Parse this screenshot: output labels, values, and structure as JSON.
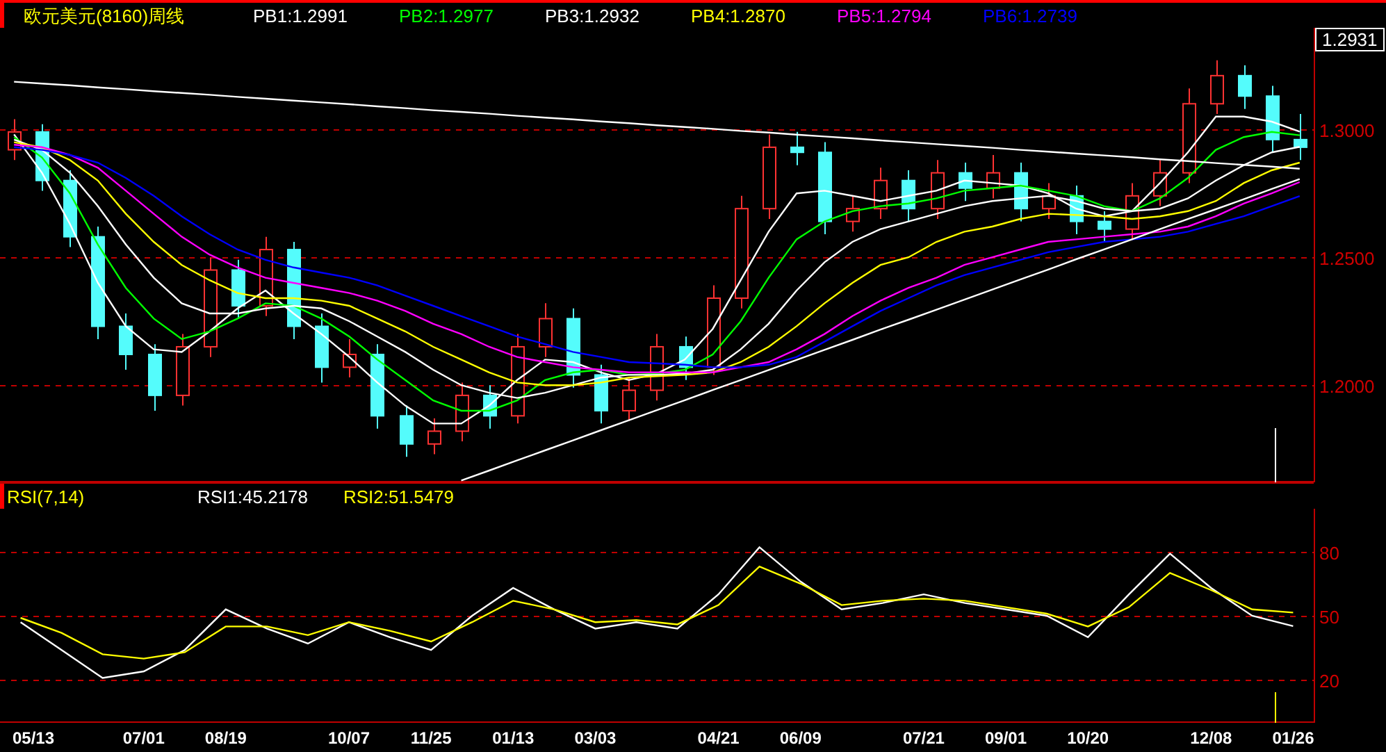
{
  "header": {
    "title": "欧元美元(8160)周线"
  },
  "price_chart": {
    "current_price": "1.2931",
    "chart_data": {
      "type": "candlestick",
      "grid": true,
      "categories": [
        null,
        null,
        null,
        null,
        null,
        null,
        null,
        null,
        null,
        null,
        null,
        null,
        null,
        null,
        null,
        null,
        null,
        null,
        null,
        null,
        null,
        null,
        null,
        null,
        null,
        null,
        null,
        null,
        null,
        null,
        null,
        null,
        null,
        null,
        null,
        null,
        null,
        null,
        null,
        null,
        null,
        null,
        null,
        null,
        null,
        null,
        null
      ],
      "ylim": [
        1.162,
        1.3397
      ],
      "yticks": [
        {
          "value": 1.2,
          "label": "1.2000"
        },
        {
          "value": 1.25,
          "label": "1.2500"
        },
        {
          "value": 1.3,
          "label": "1.3000"
        }
      ],
      "ohlc": [
        [
          1.292,
          1.304,
          1.288,
          1.299
        ],
        [
          1.299,
          1.302,
          1.276,
          1.28
        ],
        [
          1.28,
          1.284,
          1.254,
          1.258
        ],
        [
          1.258,
          1.262,
          1.218,
          1.223
        ],
        [
          1.223,
          1.228,
          1.206,
          1.212
        ],
        [
          1.212,
          1.216,
          1.19,
          1.196
        ],
        [
          1.196,
          1.22,
          1.192,
          1.215
        ],
        [
          1.215,
          1.25,
          1.211,
          1.245
        ],
        [
          1.245,
          1.249,
          1.226,
          1.231
        ],
        [
          1.231,
          1.258,
          1.227,
          1.253
        ],
        [
          1.253,
          1.256,
          1.218,
          1.223
        ],
        [
          1.223,
          1.228,
          1.201,
          1.207
        ],
        [
          1.207,
          1.218,
          1.203,
          1.212
        ],
        [
          1.212,
          1.216,
          1.183,
          1.188
        ],
        [
          1.188,
          1.192,
          1.172,
          1.177
        ],
        [
          1.177,
          1.187,
          1.173,
          1.182
        ],
        [
          1.182,
          1.201,
          1.178,
          1.196
        ],
        [
          1.196,
          1.2,
          1.183,
          1.188
        ],
        [
          1.188,
          1.22,
          1.185,
          1.215
        ],
        [
          1.215,
          1.232,
          1.211,
          1.226
        ],
        [
          1.226,
          1.23,
          1.199,
          1.204
        ],
        [
          1.204,
          1.208,
          1.185,
          1.19
        ],
        [
          1.19,
          1.203,
          1.186,
          1.198
        ],
        [
          1.198,
          1.22,
          1.194,
          1.215
        ],
        [
          1.215,
          1.219,
          1.202,
          1.207
        ],
        [
          1.207,
          1.239,
          1.204,
          1.234
        ],
        [
          1.234,
          1.274,
          1.23,
          1.269
        ],
        [
          1.269,
          1.298,
          1.265,
          1.293
        ],
        [
          1.293,
          1.299,
          1.286,
          1.291
        ],
        [
          1.291,
          1.295,
          1.259,
          1.264
        ],
        [
          1.264,
          1.274,
          1.26,
          1.269
        ],
        [
          1.269,
          1.285,
          1.265,
          1.28
        ],
        [
          1.28,
          1.284,
          1.264,
          1.269
        ],
        [
          1.269,
          1.288,
          1.265,
          1.283
        ],
        [
          1.283,
          1.287,
          1.272,
          1.277
        ],
        [
          1.277,
          1.29,
          1.273,
          1.283
        ],
        [
          1.283,
          1.287,
          1.264,
          1.269
        ],
        [
          1.269,
          1.279,
          1.265,
          1.274
        ],
        [
          1.274,
          1.278,
          1.259,
          1.264
        ],
        [
          1.264,
          1.268,
          1.256,
          1.261
        ],
        [
          1.261,
          1.279,
          1.257,
          1.274
        ],
        [
          1.274,
          1.288,
          1.27,
          1.283
        ],
        [
          1.283,
          1.316,
          1.279,
          1.31
        ],
        [
          1.31,
          1.327,
          1.306,
          1.321
        ],
        [
          1.321,
          1.325,
          1.308,
          1.313
        ],
        [
          1.313,
          1.317,
          1.291,
          1.296
        ],
        [
          1.296,
          1.306,
          1.288,
          1.293
        ]
      ],
      "series": [
        {
          "name": "PB1:1.2991",
          "type": "line",
          "color": "#ffffff",
          "values": [
            1.298,
            1.283,
            1.263,
            1.24,
            1.223,
            1.214,
            1.213,
            1.221,
            1.23,
            1.237,
            1.228,
            1.22,
            1.211,
            1.201,
            1.192,
            1.185,
            1.185,
            1.192,
            1.202,
            1.21,
            1.209,
            1.205,
            1.202,
            1.2045,
            1.21,
            1.222,
            1.241,
            1.26,
            1.275,
            1.276,
            1.274,
            1.272,
            1.274,
            1.276,
            1.28,
            1.279,
            1.278,
            1.275,
            1.269,
            1.266,
            1.268,
            1.279,
            1.291,
            1.305,
            1.305,
            1.303,
            1.2991
          ]
        },
        {
          "name": "PB2:1.2977",
          "type": "line",
          "color": "#00ff00",
          "values": [
            1.297,
            1.289,
            1.275,
            1.255,
            1.238,
            1.226,
            1.218,
            1.221,
            1.226,
            1.232,
            1.231,
            1.226,
            1.219,
            1.21,
            1.202,
            1.194,
            1.19,
            1.19,
            1.194,
            1.202,
            1.205,
            1.206,
            1.204,
            1.2045,
            1.206,
            1.212,
            1.225,
            1.242,
            1.257,
            1.264,
            1.268,
            1.27,
            1.271,
            1.273,
            1.276,
            1.277,
            1.278,
            1.276,
            1.274,
            1.27,
            1.268,
            1.273,
            1.281,
            1.292,
            1.297,
            1.299,
            1.2977
          ]
        },
        {
          "name": "PB3:1.2932",
          "type": "line",
          "color": "#ffffff",
          "values": [
            1.296,
            1.292,
            1.283,
            1.27,
            1.255,
            1.242,
            1.232,
            1.228,
            1.228,
            1.23,
            1.231,
            1.23,
            1.225,
            1.219,
            1.213,
            1.206,
            1.2,
            1.197,
            1.195,
            1.197,
            1.2,
            1.203,
            1.204,
            1.204,
            1.2045,
            1.206,
            1.214,
            1.224,
            1.237,
            1.248,
            1.256,
            1.261,
            1.264,
            1.267,
            1.27,
            1.272,
            1.273,
            1.274,
            1.272,
            1.269,
            1.268,
            1.269,
            1.273,
            1.28,
            1.286,
            1.291,
            1.2932
          ]
        },
        {
          "name": "PB4:1.2870",
          "type": "line",
          "color": "#ffff00",
          "values": [
            1.295,
            1.293,
            1.288,
            1.28,
            1.267,
            1.256,
            1.247,
            1.241,
            1.236,
            1.234,
            1.234,
            1.233,
            1.231,
            1.226,
            1.221,
            1.215,
            1.21,
            1.205,
            1.201,
            1.2,
            1.2,
            1.201,
            1.203,
            1.2035,
            1.204,
            1.205,
            1.209,
            1.215,
            1.223,
            1.232,
            1.24,
            1.247,
            1.25,
            1.256,
            1.26,
            1.262,
            1.265,
            1.267,
            1.2665,
            1.266,
            1.265,
            1.266,
            1.268,
            1.272,
            1.279,
            1.284,
            1.287
          ]
        },
        {
          "name": "PB5:1.2794",
          "type": "line",
          "color": "#ff00ff",
          "values": [
            1.294,
            1.293,
            1.29,
            1.285,
            1.276,
            1.267,
            1.258,
            1.251,
            1.246,
            1.242,
            1.24,
            1.238,
            1.236,
            1.233,
            1.229,
            1.224,
            1.22,
            1.215,
            1.211,
            1.209,
            1.207,
            1.206,
            1.205,
            1.205,
            1.205,
            1.205,
            1.207,
            1.209,
            1.214,
            1.22,
            1.227,
            1.233,
            1.238,
            1.242,
            1.247,
            1.25,
            1.253,
            1.256,
            1.257,
            1.258,
            1.259,
            1.26,
            1.262,
            1.266,
            1.271,
            1.275,
            1.2794
          ]
        },
        {
          "name": "PB6:1.2739",
          "type": "line",
          "color": "#0000ff",
          "values": [
            1.293,
            1.292,
            1.29,
            1.287,
            1.281,
            1.274,
            1.266,
            1.259,
            1.253,
            1.249,
            1.246,
            1.244,
            1.242,
            1.239,
            1.235,
            1.231,
            1.227,
            1.223,
            1.219,
            1.216,
            1.213,
            1.211,
            1.209,
            1.2085,
            1.208,
            1.207,
            1.207,
            1.208,
            1.211,
            1.217,
            1.223,
            1.229,
            1.234,
            1.239,
            1.243,
            1.246,
            1.249,
            1.252,
            1.254,
            1.256,
            1.257,
            1.258,
            1.26,
            1.263,
            1.266,
            1.27,
            1.2739
          ]
        },
        {
          "type": "line",
          "color": "#ffffff",
          "values": [
            1.3186,
            1.3179,
            1.3172,
            1.3164,
            1.3157,
            1.3149,
            1.3142,
            1.3135,
            1.3127,
            1.312,
            1.3112,
            1.3105,
            1.3098,
            1.309,
            1.3083,
            1.3075,
            1.3068,
            1.3061,
            1.3053,
            1.3046,
            1.3039,
            1.3031,
            1.3024,
            1.3016,
            1.3009,
            1.3002,
            1.2994,
            1.2987,
            1.2979,
            1.2972,
            1.2965,
            1.2957,
            1.295,
            1.2942,
            1.2935,
            1.2928,
            1.292,
            1.2913,
            1.2905,
            1.2898,
            1.2891,
            1.2883,
            1.2876,
            1.2868,
            1.2861,
            1.2854,
            1.2846
          ]
        },
        {
          "type": "line",
          "color": "#ffffff",
          "values": [
            null,
            null,
            null,
            null,
            null,
            null,
            null,
            null,
            null,
            null,
            null,
            null,
            null,
            null,
            null,
            null,
            1.1627,
            1.1666,
            1.1706,
            1.1745,
            1.1784,
            1.1824,
            1.1863,
            1.1902,
            1.1941,
            1.1981,
            1.202,
            1.2059,
            1.2099,
            1.2138,
            1.2177,
            1.2217,
            1.2256,
            1.2295,
            1.2334,
            1.2374,
            1.2413,
            1.2452,
            1.2492,
            1.2531,
            1.257,
            1.261,
            1.2649,
            1.2688,
            1.2727,
            1.2767,
            1.2806
          ]
        }
      ]
    }
  },
  "rsi_panel": {
    "title": "RSI(7,14)",
    "chart_data": {
      "type": "line",
      "grid": true,
      "categories": [
        "05/13",
        null,
        null,
        "07/01",
        null,
        "08/19",
        null,
        null,
        "10/07",
        null,
        "11/25",
        null,
        "01/13",
        null,
        "03/03",
        null,
        null,
        "04/21",
        null,
        "06/09",
        null,
        null,
        "07/21",
        null,
        "09/01",
        null,
        "10/20",
        null,
        null,
        "12/08",
        null,
        "01/26"
      ],
      "ylim": [
        0,
        100
      ],
      "yticks": [
        20,
        50,
        80
      ],
      "series": [
        {
          "name": "RSI1:45.2178",
          "color": "#ffffff",
          "values": [
            47,
            34,
            21,
            24,
            34,
            53,
            44,
            37,
            47,
            40,
            34,
            50,
            63,
            53,
            44,
            47,
            44,
            60,
            82,
            66,
            53,
            56,
            60,
            56,
            53,
            50,
            40,
            60,
            79,
            63,
            50,
            45.2
          ]
        },
        {
          "name": "RSI2:51.5479",
          "color": "#ffff00",
          "values": [
            49,
            42,
            32,
            30,
            33,
            45,
            45,
            41,
            47,
            43,
            38,
            47,
            57,
            53,
            47,
            48,
            46,
            55,
            73,
            65,
            55,
            57,
            58,
            57,
            54,
            51,
            45,
            54,
            70,
            62,
            53,
            51.5
          ]
        }
      ]
    }
  }
}
